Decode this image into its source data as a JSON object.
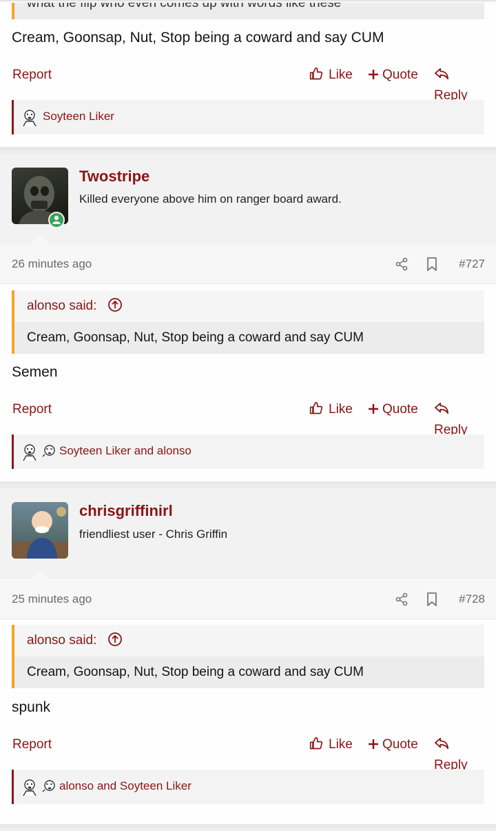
{
  "top_fragment": {
    "quoted_tail": "what the flip who even comes up with words like these",
    "post_text": "Cream, Goonsap, Nut, Stop being a coward and say CUM",
    "actions": {
      "report": "Report",
      "like": "Like",
      "quote": "Quote",
      "reply": "Reply"
    },
    "reactions": "Soyteen Liker"
  },
  "posts": [
    {
      "username": "Twostripe",
      "user_title": "Killed everyone above him on ranger board award.",
      "time": "26 minutes ago",
      "number": "#727",
      "quote_author": "alonso said:",
      "quote_text": "Cream, Goonsap, Nut, Stop being a coward and say CUM",
      "text": "Semen",
      "actions": {
        "report": "Report",
        "like": "Like",
        "quote": "Quote",
        "reply": "Reply"
      },
      "reactions": "Soyteen Liker and alonso"
    },
    {
      "username": "chrisgriffinirl",
      "user_title": "friendliest user - Chris Griffin",
      "time": "25 minutes ago",
      "number": "#728",
      "quote_author": "alonso said:",
      "quote_text": "Cream, Goonsap, Nut, Stop being a coward and say CUM",
      "text": "spunk",
      "actions": {
        "report": "Report",
        "like": "Like",
        "quote": "Quote",
        "reply": "Reply"
      },
      "reactions": "alonso and Soyteen Liker"
    }
  ],
  "colors": {
    "accent": "#8a1515",
    "quote_border": "#f5a623",
    "online": "#3aa157"
  }
}
